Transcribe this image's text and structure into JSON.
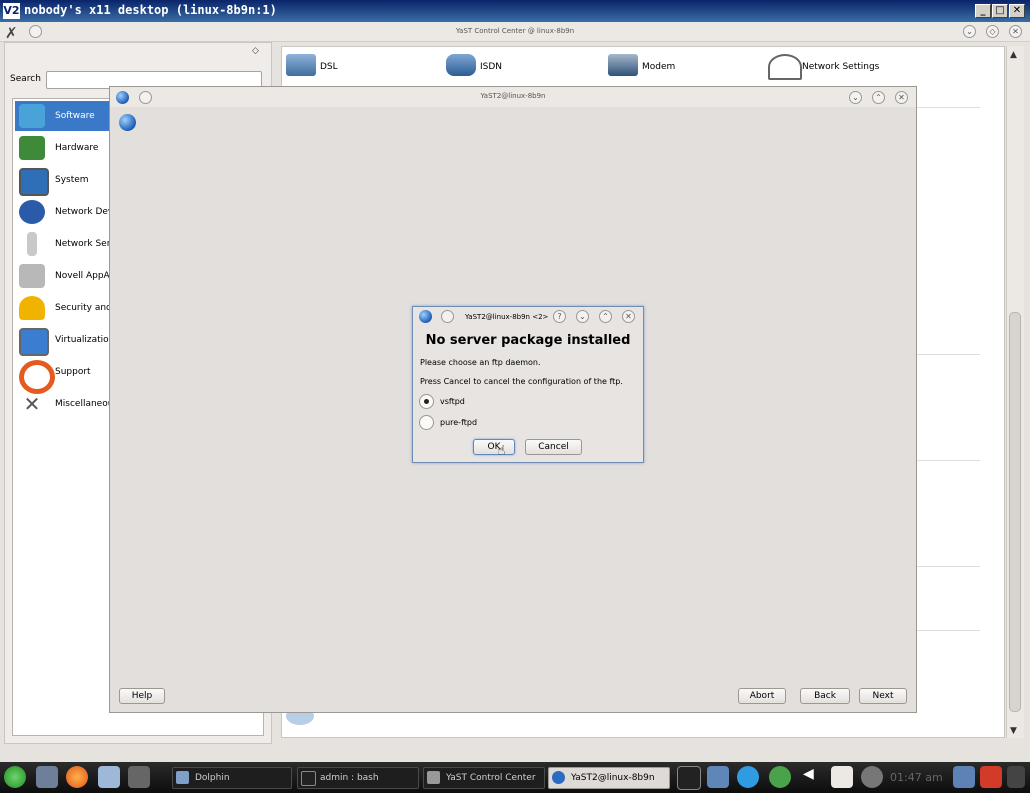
{
  "vnc": {
    "title": "nobody's x11 desktop (linux-8b9n:1)",
    "logo": "V2"
  },
  "control_center": {
    "title": "YaST Control Center @ linux-8b9n",
    "search_label": "Search",
    "search_value": "",
    "categories": [
      {
        "label": "Software",
        "icon": "software-icon",
        "selected": true
      },
      {
        "label": "Hardware",
        "icon": "hardware-icon"
      },
      {
        "label": "System",
        "icon": "system-icon"
      },
      {
        "label": "Network Dev",
        "icon": "network-devices-icon"
      },
      {
        "label": "Network Serv",
        "icon": "network-services-icon"
      },
      {
        "label": "Novell AppAr",
        "icon": "novell-apparmor-icon"
      },
      {
        "label": "Security and",
        "icon": "security-icon"
      },
      {
        "label": "Virtualization",
        "icon": "virtualization-icon"
      },
      {
        "label": "Support",
        "icon": "support-icon"
      },
      {
        "label": "Miscellaneous",
        "icon": "miscellaneous-icon"
      }
    ],
    "modules": [
      {
        "label": "DSL",
        "icon": "dsl-icon"
      },
      {
        "label": "ISDN",
        "icon": "isdn-icon"
      },
      {
        "label": "Modem",
        "icon": "modem-icon"
      },
      {
        "label": "Network Settings",
        "icon": "network-settings-icon"
      }
    ]
  },
  "yast_window": {
    "title": "YaST2@linux-8b9n",
    "buttons": {
      "help": "Help",
      "abort": "Abort",
      "back": "Back",
      "next": "Next"
    }
  },
  "dialog": {
    "title": "YaST2@linux-8b9n <2>",
    "heading": "No server package installed",
    "message_line1": "Please choose an ftp daemon.",
    "message_line2": "Press Cancel to cancel the configuration of the ftp.",
    "options": [
      {
        "label": "vsftpd",
        "checked": true
      },
      {
        "label": "pure-ftpd",
        "checked": false
      }
    ],
    "ok": "OK",
    "cancel": "Cancel"
  },
  "taskbar": {
    "tasks": [
      {
        "label": "Dolphin",
        "active": false
      },
      {
        "label": "admin : bash",
        "active": false
      },
      {
        "label": "YaST Control Center",
        "active": false
      },
      {
        "label": "YaST2@linux-8b9n",
        "active": true
      }
    ],
    "clock": "01:47 am"
  },
  "colors": {
    "selection": "#3a78c8",
    "vnc_title": "#0a246a"
  }
}
